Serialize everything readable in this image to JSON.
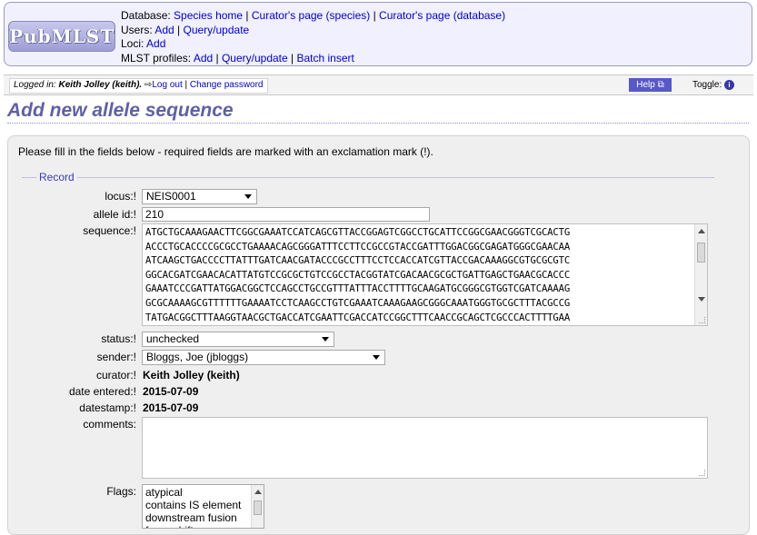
{
  "header": {
    "logo_text": "PubMLST",
    "database_label": "Database:",
    "database_links": [
      "Species home",
      "Curator's page (species)",
      "Curator's page (database)"
    ],
    "users_label": "Users:",
    "users_links": [
      "Add",
      "Query/update"
    ],
    "loci_label": "Loci:",
    "loci_links": [
      "Add"
    ],
    "mlst_label": "MLST profiles:",
    "mlst_links": [
      "Add",
      "Query/update",
      "Batch insert"
    ]
  },
  "status_bar": {
    "logged_in_label": "Logged in:",
    "user": "Keith Jolley (keith).",
    "logout": "Log out",
    "change_password": "Change password",
    "help": "Help",
    "toggle": "Toggle:"
  },
  "page": {
    "title": "Add new allele sequence",
    "instructions": "Please fill in the fields below - required fields are marked with an exclamation mark (!).",
    "fieldset_legend": "Record"
  },
  "form": {
    "locus_label": "locus:!",
    "locus_value": "NEIS0001",
    "allele_id_label": "allele id:!",
    "allele_id_value": "210",
    "sequence_label": "sequence:!",
    "sequence_lines": [
      "ATGCTGCAAAGAACTTCGGCGAAATCCATCAGCGTTACCGGAGTCGGCCTGCATTCCGGCGAACGGGTCGCACTG",
      "ACCCTGCACCCCGCGCCTGAAAACAGCGGGATTTCCTTCCGCCGTACCGATTTGGACGGCGAGATGGGCGAACAA",
      "ATCAAGCTGACCCCTTATTTGATCAACGATACCCGCCTTTCCTCCACCATCGTTACCGACAAAGGCGTGCGCGTC",
      "GGCACGATCGAACACATTATGTCCGCGCTGTCCGCCTACGGTATCGACAACGCGCTGATTGAGCTGAACGCACCC",
      "GAAATCCCGATTATGGACGGCTCCAGCCTGCCGTTTATTTACCTTTTGCAAGATGCGGGCGTGGTCGATCAAAAG",
      "GCGCAAAAGCGTTTTTTGAAAATCCTCAAGCCTGTCGAAATCAAAGAAGCGGGCAAATGGGTGCGCTTTACGCCG",
      "TATGACGGCTTTAAGGTAACGCTGACCATCGAATTCGACCATCCGGCTTTCAACCGCAGCTCGCCCACTTTTGAA"
    ],
    "status_label": "status:!",
    "status_value": "unchecked",
    "sender_label": "sender:!",
    "sender_value": "Bloggs, Joe (jbloggs)",
    "curator_label": "curator:!",
    "curator_value": "Keith Jolley (keith)",
    "date_entered_label": "date entered:!",
    "date_entered_value": "2015-07-09",
    "datestamp_label": "datestamp:!",
    "datestamp_value": "2015-07-09",
    "comments_label": "comments:",
    "comments_value": "",
    "flags_label": "Flags:",
    "flags_options": [
      "atypical",
      "contains IS element",
      "downstream fusion",
      "frameshift"
    ]
  }
}
